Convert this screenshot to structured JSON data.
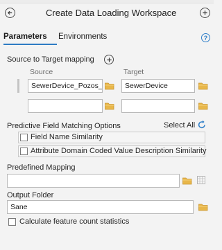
{
  "header": {
    "title": "Create Data Loading Workspace"
  },
  "tabs": [
    {
      "label": "Parameters",
      "active": true
    },
    {
      "label": "Environments",
      "active": false
    }
  ],
  "mapping": {
    "label": "Source to Target mapping",
    "source_header": "Source",
    "target_header": "Target",
    "rows": [
      {
        "source": "SewerDevice_Pozos_P",
        "target": "SewerDevice"
      },
      {
        "source": "",
        "target": ""
      }
    ]
  },
  "matching": {
    "label": "Predictive Field Matching Options",
    "select_all": "Select All",
    "options": [
      {
        "label": "Field Name Similarity",
        "checked": false
      },
      {
        "label": "Attribute Domain Coded Value Description Similarity",
        "checked": false
      }
    ]
  },
  "predefined": {
    "label": "Predefined Mapping",
    "value": ""
  },
  "output": {
    "label": "Output Folder",
    "value": "Sane"
  },
  "stats": {
    "label": "Calculate feature count statistics",
    "checked": false
  },
  "colors": {
    "accent": "#2d7bc3",
    "folder": "#e8b74a",
    "background": "#f3f3f3"
  }
}
